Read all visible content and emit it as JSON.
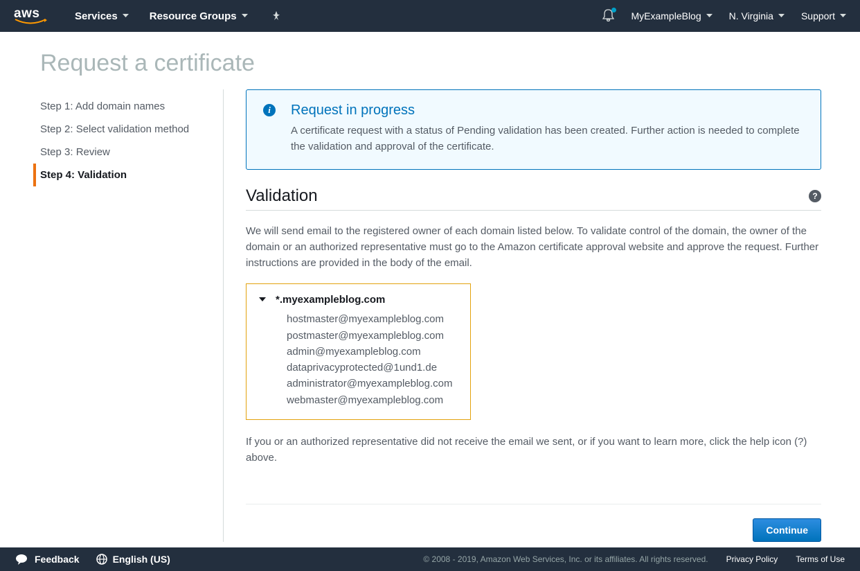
{
  "nav": {
    "services": "Services",
    "resource_groups": "Resource Groups",
    "account": "MyExampleBlog",
    "region": "N. Virginia",
    "support": "Support"
  },
  "page": {
    "title": "Request a certificate"
  },
  "steps": [
    {
      "label": "Step 1: Add domain names"
    },
    {
      "label": "Step 2: Select validation method"
    },
    {
      "label": "Step 3: Review"
    },
    {
      "label": "Step 4: Validation"
    }
  ],
  "info": {
    "title": "Request in progress",
    "text": "A certificate request with a status of Pending validation has been created. Further action is needed to complete the validation and approval of the certificate."
  },
  "section": {
    "title": "Validation",
    "description": "We will send email to the registered owner of each domain listed below. To validate control of the domain, the owner of the domain or an authorized representative must go to the Amazon certificate approval website and approve the request. Further instructions are provided in the body of the email.",
    "footer_note": "If you or an authorized representative did not receive the email we sent, or if you want to learn more, click the help icon (?) above."
  },
  "domain": {
    "name": "*.myexampleblog.com",
    "emails": [
      "hostmaster@myexampleblog.com",
      "postmaster@myexampleblog.com",
      "admin@myexampleblog.com",
      "dataprivacyprotected@1und1.de",
      "administrator@myexampleblog.com",
      "webmaster@myexampleblog.com"
    ]
  },
  "buttons": {
    "continue": "Continue"
  },
  "footer": {
    "feedback": "Feedback",
    "language": "English (US)",
    "copyright": "© 2008 - 2019, Amazon Web Services, Inc. or its affiliates. All rights reserved.",
    "privacy": "Privacy Policy",
    "terms": "Terms of Use"
  }
}
